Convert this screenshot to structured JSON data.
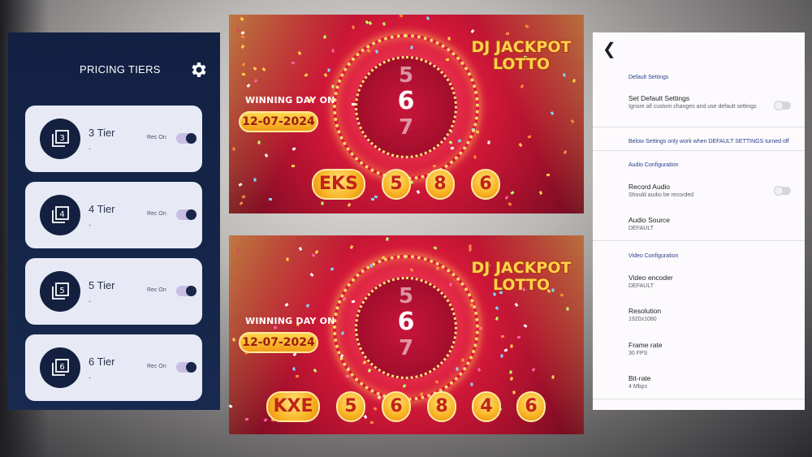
{
  "pricing": {
    "title": "PRICING TIERS",
    "gear_icon": "gear-icon",
    "tiers": [
      {
        "number": "3",
        "name": "3 Tier",
        "sub": "-",
        "rec": "Rec On",
        "on": true
      },
      {
        "number": "4",
        "name": "4 Tier",
        "sub": "-",
        "rec": "Rec On",
        "on": true
      },
      {
        "number": "5",
        "name": "5 Tier",
        "sub": "-",
        "rec": "Rec On",
        "on": true
      },
      {
        "number": "6",
        "name": "6 Tier",
        "sub": "-",
        "rec": "Rec On",
        "on": true
      }
    ]
  },
  "lotto_top": {
    "brand_line1": "DJ JACKPOT",
    "brand_line2": "LOTTO",
    "winning_label": "WINNING DAY ON",
    "date": "12-07-2024",
    "wheel": [
      "5",
      "6",
      "7"
    ],
    "code": "EKS",
    "numbers": [
      "5",
      "8",
      "6"
    ]
  },
  "lotto_bottom": {
    "brand_line1": "DJ JACKPOT",
    "brand_line2": "LOTTO",
    "winning_label": "WINNING DAY ON",
    "date": "12-07-2024",
    "wheel": [
      "5",
      "6",
      "7"
    ],
    "code": "KXE",
    "numbers": [
      "5",
      "6",
      "8",
      "4",
      "6"
    ]
  },
  "settings": {
    "back_icon": "back-arrow-icon",
    "default_section": "Default Settings",
    "set_default_title": "Set Default Settings",
    "set_default_sub": "Ignore all custom changes and use default settings",
    "notice": "Below Settings only work when DEFAULT SETTINGS turned off",
    "audio_section": "Audio Configuration",
    "record_audio_title": "Record Audio",
    "record_audio_sub": "Should audio be recorded",
    "audio_source_title": "Audio Source",
    "audio_source_value": "DEFAULT",
    "video_section": "Video Configuration",
    "video_encoder_title": "Video encoder",
    "video_encoder_value": "DEFAULT",
    "resolution_title": "Resolution",
    "resolution_value": "1920x1080",
    "frame_rate_title": "Frame rate",
    "frame_rate_value": "30 FPS",
    "bitrate_title": "Bit-rate",
    "bitrate_value": "4 Mbps"
  },
  "colors": {
    "panel_navy": "#122042",
    "card_bg": "#e7eaf5",
    "lotto_red": "#d8193a",
    "gold": "#ffd24a",
    "settings_accent": "#2c3f8f"
  }
}
